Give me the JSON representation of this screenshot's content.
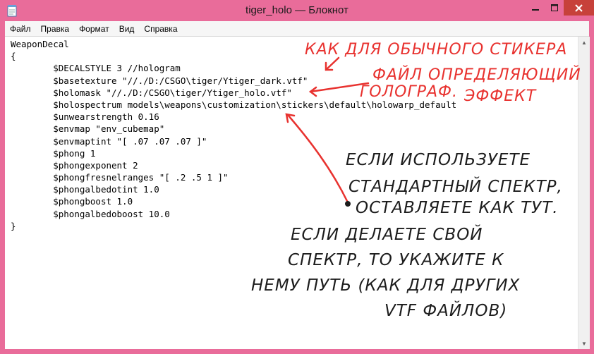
{
  "window": {
    "title": "tiger_holo — Блокнот",
    "controls": {
      "minimize_icon": "minimize-icon",
      "maximize_icon": "maximize-icon",
      "close_icon": "close-icon"
    },
    "accent_color": "#e96c9a",
    "close_color": "#c7413a"
  },
  "menu": [
    {
      "label": "Файл"
    },
    {
      "label": "Правка"
    },
    {
      "label": "Формат"
    },
    {
      "label": "Вид"
    },
    {
      "label": "Справка"
    }
  ],
  "editor": {
    "lines": [
      "WeaponDecal",
      "{",
      "\t$DECALSTYLE 3 //hologram",
      "\t$basetexture \"//./D:/CSGO\\tiger/Ytiger_dark.vtf\"",
      "\t$holomask \"//./D:/CSGO\\tiger/Ytiger_holo.vtf\"",
      "\t$holospectrum models\\weapons\\customization\\stickers\\default\\holowarp_default",
      "\t$unwearstrength 0.16",
      "\t$envmap \"env_cubemap\"",
      "\t$envmaptint \"[ .07 .07 .07 ]\"",
      "\t$phong 1",
      "\t$phongexponent 2",
      "\t$phongfresnelranges \"[ .2 .5 1 ]\"",
      "\t$phongalbedotint 1.0",
      "\t$phongboost 1.0",
      "\t$phongalbedoboost 10.0",
      "}"
    ]
  },
  "annotations": {
    "red_color": "#e8322f",
    "dark_color": "#1c1c1c",
    "red": [
      "КАК ДЛЯ ОБЫЧНОГО СТИКЕРА",
      "ФАЙЛ ОПРЕДЕЛЯЮЩИЙ",
      "ГОЛОГРАФ.",
      "ЭФФЕКТ"
    ],
    "dark": [
      "ЕСЛИ ИСПОЛЬЗУЕТЕ",
      "СТАНДАРТНЫЙ СПЕКТР,",
      "ОСТАВЛЯЕТЕ КАК ТУТ.",
      "ЕСЛИ ДЕЛАЕТЕ СВОЙ",
      "СПЕКТР, ТО УКАЖИТЕ К",
      "НЕМУ ПУТЬ (КАК ДЛЯ ДРУГИХ",
      "VTF ФАЙЛОВ)"
    ]
  }
}
